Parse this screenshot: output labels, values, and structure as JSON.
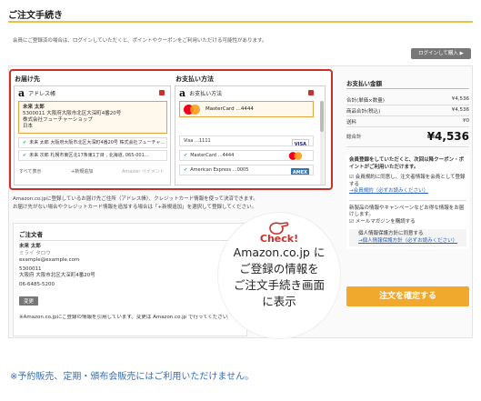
{
  "page": {
    "title": "ご注文手続き",
    "intro": "会員にご登録済の場合は、ログインしていただくと、ポイントやクーポンをご利用いただける可能性があります。",
    "login_button": "ログインして購入 ▶"
  },
  "shipping": {
    "heading": "お届け先",
    "card_label": "アドレス帳",
    "selected": {
      "name": "未来 太郎",
      "address": "5300011 大阪府大阪市北区大深町4番20号",
      "company": "株式会社フューチャーショップ",
      "country": "日本"
    },
    "others": [
      "未来 太郎 大阪府大阪市北区大深町4番20号 株式会社フューチャ…",
      "未来 次郎 札幌市東区北17条東1丁目 , 北海道, 065-001…"
    ],
    "show_all": "すべて表示",
    "add_new": "+新規追加",
    "widget_footer": "Amazon ペイメント"
  },
  "payment": {
    "heading": "お支払い方法",
    "card_label": "お支払い方法",
    "selected": "MasterCard …4444",
    "others": [
      {
        "label": "Visa …1111",
        "brand": "VISA"
      },
      {
        "label": "MasterCard …4444",
        "brand": "MC"
      },
      {
        "label": "American Express …0005",
        "brand": "AMEX"
      }
    ]
  },
  "notes": {
    "line1": "Amazon.co.jpに登録しているお届け先ご住所（アドレス帳）、クレジットカード情報を使って決済できます。",
    "line2": "お届け先がない場合やクレジットカード情報を追加する場合は「+新規追加」を選択して登録してください。"
  },
  "orderer": {
    "heading": "ご注文者",
    "name": "未来 太郎",
    "kana": "ミライ タロウ",
    "email": "example@example.com",
    "postal": "5300011",
    "address": "大阪府 大阪市北区大深町4番20号",
    "phone": "06-6485-5200",
    "change_button": "変更",
    "footnote": "※Amazon.co.jpにご登録の情報を引用しています。変更は Amazon.co.jp で行ってください。"
  },
  "summary": {
    "heading": "お支払い金額",
    "rows": [
      {
        "label": "合計(単価×数量)",
        "value": "¥4,536"
      },
      {
        "label": "商品合計(税込)",
        "value": "¥4,536"
      },
      {
        "label": "送料",
        "value": "¥0"
      }
    ],
    "total_label": "総合計",
    "total_value": "¥4,536",
    "member_line1": "会員登録をしていただくと、次回以降クーポン・ポイントがご利用いただけます。",
    "member_check": "会員規約に同意し、注文者情報を会員として登録する",
    "member_link": "→会員規約（必ずお読みください）",
    "mail_info": "新製品の情報やキャンペーンなどお得な情報をお届けします。",
    "mail_check": "メールマガジンを購読する",
    "privacy_text": "個人情報保護方針に同意する",
    "privacy_link": "→個人情報保護方針（必ずお読みください）",
    "confirm_button": "注文を確定する"
  },
  "callout": {
    "check": "Check!",
    "lines": [
      "Amazon.co.jp に",
      "ご登録の情報を",
      "ご注文手続き画面",
      "に表示"
    ]
  },
  "footer_note": "※予約販売、定期・頒布会販売にはご利用いただけません。",
  "colors": {
    "accent_red": "#c9302c",
    "accent_orange": "#f0a82d",
    "rule_yellow": "#f0c040",
    "note_blue": "#3a6fb2"
  }
}
